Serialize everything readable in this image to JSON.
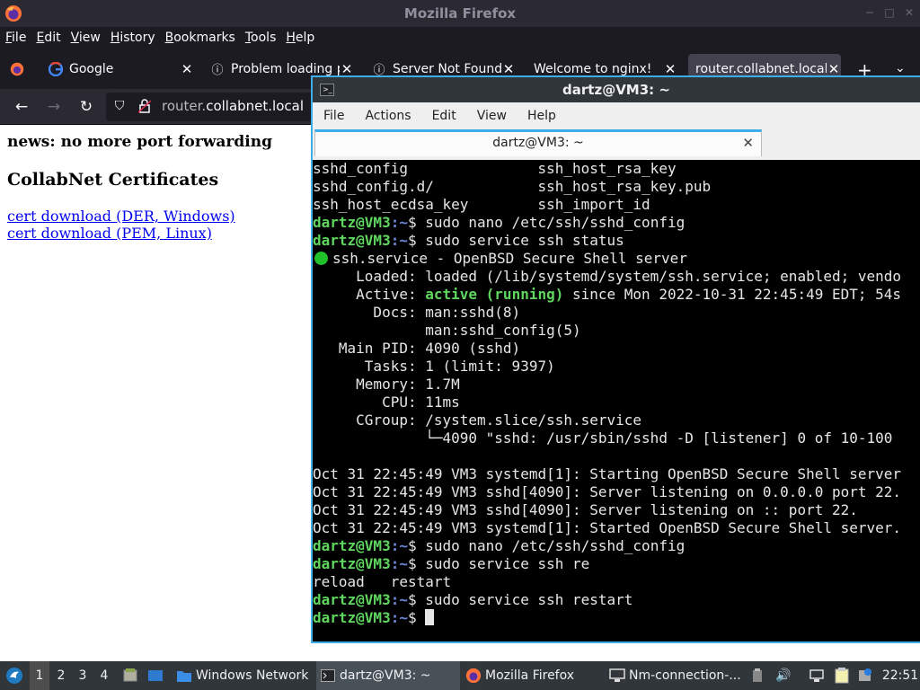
{
  "firefox": {
    "window_title": "Mozilla Firefox",
    "menu": [
      "File",
      "Edit",
      "View",
      "History",
      "Bookmarks",
      "Tools",
      "Help"
    ],
    "tabs": [
      {
        "label": "Google",
        "icon": "google-icon"
      },
      {
        "label": "Problem loading page",
        "icon": "info-icon"
      },
      {
        "label": "Server Not Found",
        "icon": "info-icon"
      },
      {
        "label": "Welcome to nginx!",
        "icon": "none"
      },
      {
        "label": "router.collabnet.local/",
        "icon": "none"
      }
    ],
    "new_tab": "+",
    "url_host": "router.collabnet.local",
    "url_pre": "router.",
    "url_domain": "collabnet.local",
    "page": {
      "news": "news: no more port forwarding",
      "heading": "CollabNet Certificates",
      "links": [
        "cert download (DER, Windows)",
        "cert download (PEM, Linux)"
      ]
    }
  },
  "terminal": {
    "window_title": "dartz@VM3: ~",
    "menu": [
      "File",
      "Actions",
      "Edit",
      "View",
      "Help"
    ],
    "tab_label": "dartz@VM3: ~",
    "prompt_user": "dartz@VM3",
    "prompt_path": ":~",
    "prompt_sym": "$ ",
    "lines": {
      "l1": "sshd_config               ssh_host_rsa_key",
      "l2": "sshd_config.d/            ssh_host_rsa_key.pub",
      "l3": "ssh_host_ecdsa_key        ssh_import_id",
      "l4": "sudo nano /etc/ssh/sshd_config",
      "l5": "sudo service ssh status",
      "l6": "ssh.service - OpenBSD Secure Shell server",
      "l7": "     Loaded: loaded (/lib/systemd/system/ssh.service; enabled; vendo",
      "l8a": "     Active: ",
      "l8b": "active (running)",
      "l8c": " since Mon 2022-10-31 22:45:49 EDT; 54s",
      "l9": "       Docs: man:sshd(8)",
      "l10": "             man:sshd_config(5)",
      "l11": "   Main PID: 4090 (sshd)",
      "l12": "      Tasks: 1 (limit: 9397)",
      "l13": "     Memory: 1.7M",
      "l14": "        CPU: 11ms",
      "l15": "     CGroup: /system.slice/ssh.service",
      "l16": "             └─4090 \"sshd: /usr/sbin/sshd -D [listener] 0 of 10-100",
      "l17": "",
      "l18": "Oct 31 22:45:49 VM3 systemd[1]: Starting OpenBSD Secure Shell server",
      "l19": "Oct 31 22:45:49 VM3 sshd[4090]: Server listening on 0.0.0.0 port 22.",
      "l20": "Oct 31 22:45:49 VM3 sshd[4090]: Server listening on :: port 22.",
      "l21": "Oct 31 22:45:49 VM3 systemd[1]: Started OpenBSD Secure Shell server.",
      "l22": "sudo nano /etc/ssh/sshd_config",
      "l23": "sudo service ssh re",
      "l24": "reload   restart",
      "l25": "sudo service ssh restart"
    }
  },
  "taskbar": {
    "workspaces": [
      "1",
      "2",
      "3",
      "4"
    ],
    "tasks": [
      {
        "label": "Windows Network",
        "icon": "folder-icon"
      },
      {
        "label": "dartz@VM3: ~",
        "icon": "terminal-icon"
      },
      {
        "label": "Mozilla Firefox",
        "icon": "firefox-icon"
      },
      {
        "label": "Nm-connection-...",
        "icon": "network-icon"
      }
    ],
    "clock": "22:51"
  },
  "colors": {
    "firefox_dark": "#1c1b22",
    "terminal_accent": "#3daee9",
    "prompt_green": "#5fd75f",
    "prompt_blue": "#6d88d8",
    "link_blue": "#0000ee"
  }
}
